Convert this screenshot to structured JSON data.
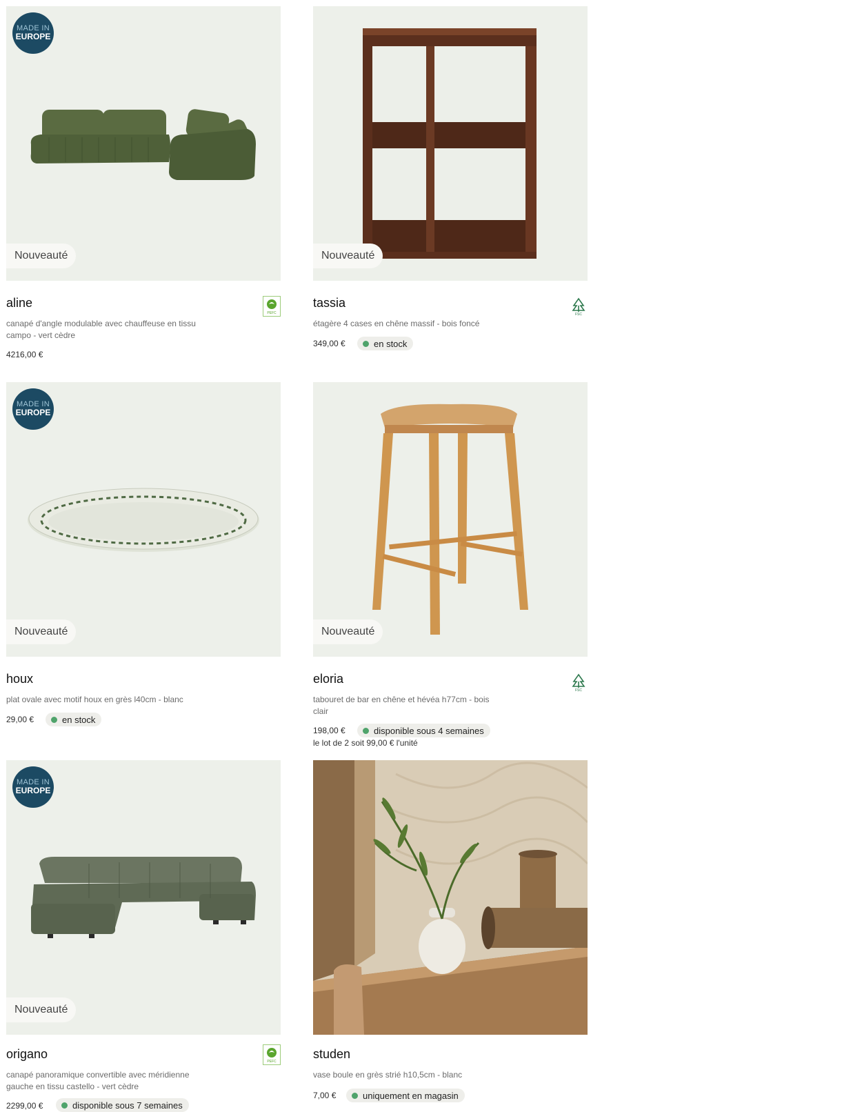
{
  "badges": {
    "europe_line1": "MADE IN",
    "europe_line2": "EUROPE",
    "new_label": "Nouveauté"
  },
  "products": [
    {
      "name": "aline",
      "desc": "canapé d'angle modulable avec chauffeuse en tissu campo - vert cèdre",
      "price": "4216,00 €",
      "certification": "PEFC"
    },
    {
      "name": "tassia",
      "desc": "étagère 4 cases en chêne massif - bois foncé",
      "price": "349,00 €",
      "stock": "en stock",
      "certification": "FSC"
    },
    {
      "name": "houx",
      "desc": "plat ovale avec motif houx en grès l40cm - blanc",
      "price": "29,00 €",
      "stock": "en stock"
    },
    {
      "name": "eloria",
      "desc": "tabouret de bar en chêne et hévéa h77cm - bois clair",
      "price": "198,00 €",
      "stock": "disponible sous 4 semaines",
      "lot": "le lot de 2 soit 99,00 € l'unité",
      "certification": "FSC"
    },
    {
      "name": "origano",
      "desc": "canapé panoramique convertible avec méridienne gauche en tissu castello - vert cèdre",
      "price": "2299,00 €",
      "stock": "disponible sous 7 semaines",
      "certification": "PEFC"
    },
    {
      "name": "studen",
      "desc": "vase boule en grès strié h10,5cm - blanc",
      "price": "7,00 €",
      "stock": "uniquement en magasin"
    }
  ],
  "colors": {
    "stock_dot": "#4fa36b",
    "image_bg": "#edf0ea",
    "europe_badge": "#1c4a63",
    "pefc_green": "#5aa52e",
    "fsc_green": "#2f7a4f"
  }
}
